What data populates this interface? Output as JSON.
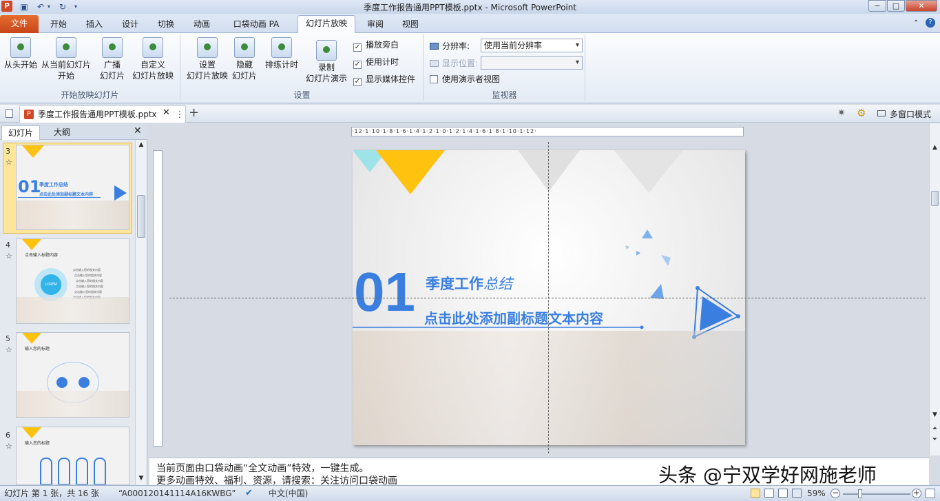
{
  "window": {
    "title": "季度工作报告通用PPT模板.pptx - Microsoft PowerPoint",
    "app_icon": "P",
    "controls": {
      "minimize": "−",
      "maximize": "□",
      "close": "✕"
    }
  },
  "ribbon_tabs": {
    "file": "文件",
    "items": [
      "开始",
      "插入",
      "设计",
      "切换",
      "动画",
      "口袋动画 PA",
      "幻灯片放映",
      "审阅",
      "视图"
    ],
    "active": "幻灯片放映"
  },
  "ribbon": {
    "group_start": {
      "label": "开始放映幻灯片",
      "from_start": "从头开始",
      "from_current_1": "从当前幻灯片",
      "from_current_2": "开始",
      "broadcast_1": "广播",
      "broadcast_2": "幻灯片",
      "custom_1": "自定义",
      "custom_2": "幻灯片放映"
    },
    "group_setup": {
      "label": "设置",
      "setup_1": "设置",
      "setup_2": "幻灯片放映",
      "hide_1": "隐藏",
      "hide_2": "幻灯片",
      "rehearse": "排练计时",
      "record_1": "录制",
      "record_2": "幻灯片演示",
      "play_narration": "播放旁白",
      "use_timings": "使用计时",
      "show_media_controls": "显示媒体控件"
    },
    "group_monitor": {
      "label": "监视器",
      "resolution_label": "分辨率:",
      "resolution_value": "使用当前分辨率",
      "show_on_label": "显示位置:",
      "show_on_value": "",
      "presenter_view": "使用演示者视图"
    }
  },
  "doc_tabs": {
    "tab_label": "季度工作报告通用PPT模板.pptx",
    "more": "⋮",
    "close": "✕",
    "add": "+",
    "multi_window": "多窗口模式"
  },
  "left_panel": {
    "tabs": [
      "幻灯片",
      "大纲"
    ],
    "close": "✕",
    "thumbnails": [
      {
        "num": "3",
        "star": "☆",
        "title": "季度工作总结",
        "big": "01",
        "sub": "点击此处添加副标题文本内容"
      },
      {
        "num": "4",
        "star": "☆",
        "title": "点击输入标题内容",
        "center": "LOREM",
        "lines": [
          "点击输入您的相关内容",
          "点击输入您的相关内容",
          "点击输入您的相关内容",
          "点击输入您的相关内容",
          "点击输入您的相关内容",
          "点击输入您的相关内容"
        ]
      },
      {
        "num": "5",
        "star": "☆",
        "title": "输入您的标题"
      },
      {
        "num": "6",
        "star": "☆",
        "title": "输入您的标题"
      }
    ]
  },
  "ruler": {
    "h_ticks": "·12·1·10·1·8·1·6·1·4·1·2·1·0·1·2·1·4·1·6·1·8·1·10·1·12·"
  },
  "slide": {
    "number": "01",
    "title_main": "季度工作",
    "title_italic": "总结",
    "subtitle": "点击此处添加副标题文本内容",
    "accent_color": "#3a7fe0",
    "yellow_color": "#ffc20e"
  },
  "notes": {
    "line1": "当前页面由口袋动画“全文动画”特效，一键生成。",
    "line2": "更多动画特效、福利、资源，请搜索：关注访问口袋动画"
  },
  "watermark": "头条 @宁双学好网施老师",
  "status": {
    "slide_info": "幻灯片 第 1 张，共 16 张",
    "theme": "“A000120141114A16KWBG”",
    "language": "中文(中国)",
    "zoom": "59%"
  }
}
